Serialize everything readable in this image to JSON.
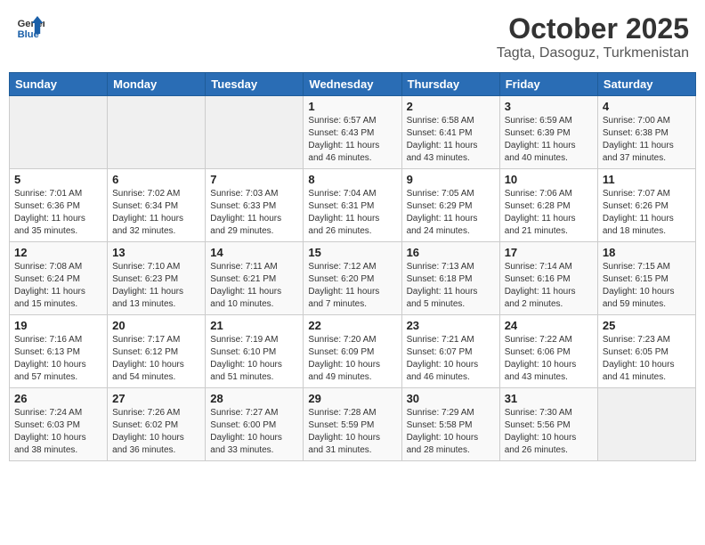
{
  "header": {
    "logo_line1": "General",
    "logo_line2": "Blue",
    "month": "October 2025",
    "location": "Tagta, Dasoguz, Turkmenistan"
  },
  "weekdays": [
    "Sunday",
    "Monday",
    "Tuesday",
    "Wednesday",
    "Thursday",
    "Friday",
    "Saturday"
  ],
  "weeks": [
    [
      {
        "day": "",
        "info": ""
      },
      {
        "day": "",
        "info": ""
      },
      {
        "day": "",
        "info": ""
      },
      {
        "day": "1",
        "info": "Sunrise: 6:57 AM\nSunset: 6:43 PM\nDaylight: 11 hours\nand 46 minutes."
      },
      {
        "day": "2",
        "info": "Sunrise: 6:58 AM\nSunset: 6:41 PM\nDaylight: 11 hours\nand 43 minutes."
      },
      {
        "day": "3",
        "info": "Sunrise: 6:59 AM\nSunset: 6:39 PM\nDaylight: 11 hours\nand 40 minutes."
      },
      {
        "day": "4",
        "info": "Sunrise: 7:00 AM\nSunset: 6:38 PM\nDaylight: 11 hours\nand 37 minutes."
      }
    ],
    [
      {
        "day": "5",
        "info": "Sunrise: 7:01 AM\nSunset: 6:36 PM\nDaylight: 11 hours\nand 35 minutes."
      },
      {
        "day": "6",
        "info": "Sunrise: 7:02 AM\nSunset: 6:34 PM\nDaylight: 11 hours\nand 32 minutes."
      },
      {
        "day": "7",
        "info": "Sunrise: 7:03 AM\nSunset: 6:33 PM\nDaylight: 11 hours\nand 29 minutes."
      },
      {
        "day": "8",
        "info": "Sunrise: 7:04 AM\nSunset: 6:31 PM\nDaylight: 11 hours\nand 26 minutes."
      },
      {
        "day": "9",
        "info": "Sunrise: 7:05 AM\nSunset: 6:29 PM\nDaylight: 11 hours\nand 24 minutes."
      },
      {
        "day": "10",
        "info": "Sunrise: 7:06 AM\nSunset: 6:28 PM\nDaylight: 11 hours\nand 21 minutes."
      },
      {
        "day": "11",
        "info": "Sunrise: 7:07 AM\nSunset: 6:26 PM\nDaylight: 11 hours\nand 18 minutes."
      }
    ],
    [
      {
        "day": "12",
        "info": "Sunrise: 7:08 AM\nSunset: 6:24 PM\nDaylight: 11 hours\nand 15 minutes."
      },
      {
        "day": "13",
        "info": "Sunrise: 7:10 AM\nSunset: 6:23 PM\nDaylight: 11 hours\nand 13 minutes."
      },
      {
        "day": "14",
        "info": "Sunrise: 7:11 AM\nSunset: 6:21 PM\nDaylight: 11 hours\nand 10 minutes."
      },
      {
        "day": "15",
        "info": "Sunrise: 7:12 AM\nSunset: 6:20 PM\nDaylight: 11 hours\nand 7 minutes."
      },
      {
        "day": "16",
        "info": "Sunrise: 7:13 AM\nSunset: 6:18 PM\nDaylight: 11 hours\nand 5 minutes."
      },
      {
        "day": "17",
        "info": "Sunrise: 7:14 AM\nSunset: 6:16 PM\nDaylight: 11 hours\nand 2 minutes."
      },
      {
        "day": "18",
        "info": "Sunrise: 7:15 AM\nSunset: 6:15 PM\nDaylight: 10 hours\nand 59 minutes."
      }
    ],
    [
      {
        "day": "19",
        "info": "Sunrise: 7:16 AM\nSunset: 6:13 PM\nDaylight: 10 hours\nand 57 minutes."
      },
      {
        "day": "20",
        "info": "Sunrise: 7:17 AM\nSunset: 6:12 PM\nDaylight: 10 hours\nand 54 minutes."
      },
      {
        "day": "21",
        "info": "Sunrise: 7:19 AM\nSunset: 6:10 PM\nDaylight: 10 hours\nand 51 minutes."
      },
      {
        "day": "22",
        "info": "Sunrise: 7:20 AM\nSunset: 6:09 PM\nDaylight: 10 hours\nand 49 minutes."
      },
      {
        "day": "23",
        "info": "Sunrise: 7:21 AM\nSunset: 6:07 PM\nDaylight: 10 hours\nand 46 minutes."
      },
      {
        "day": "24",
        "info": "Sunrise: 7:22 AM\nSunset: 6:06 PM\nDaylight: 10 hours\nand 43 minutes."
      },
      {
        "day": "25",
        "info": "Sunrise: 7:23 AM\nSunset: 6:05 PM\nDaylight: 10 hours\nand 41 minutes."
      }
    ],
    [
      {
        "day": "26",
        "info": "Sunrise: 7:24 AM\nSunset: 6:03 PM\nDaylight: 10 hours\nand 38 minutes."
      },
      {
        "day": "27",
        "info": "Sunrise: 7:26 AM\nSunset: 6:02 PM\nDaylight: 10 hours\nand 36 minutes."
      },
      {
        "day": "28",
        "info": "Sunrise: 7:27 AM\nSunset: 6:00 PM\nDaylight: 10 hours\nand 33 minutes."
      },
      {
        "day": "29",
        "info": "Sunrise: 7:28 AM\nSunset: 5:59 PM\nDaylight: 10 hours\nand 31 minutes."
      },
      {
        "day": "30",
        "info": "Sunrise: 7:29 AM\nSunset: 5:58 PM\nDaylight: 10 hours\nand 28 minutes."
      },
      {
        "day": "31",
        "info": "Sunrise: 7:30 AM\nSunset: 5:56 PM\nDaylight: 10 hours\nand 26 minutes."
      },
      {
        "day": "",
        "info": ""
      }
    ]
  ]
}
